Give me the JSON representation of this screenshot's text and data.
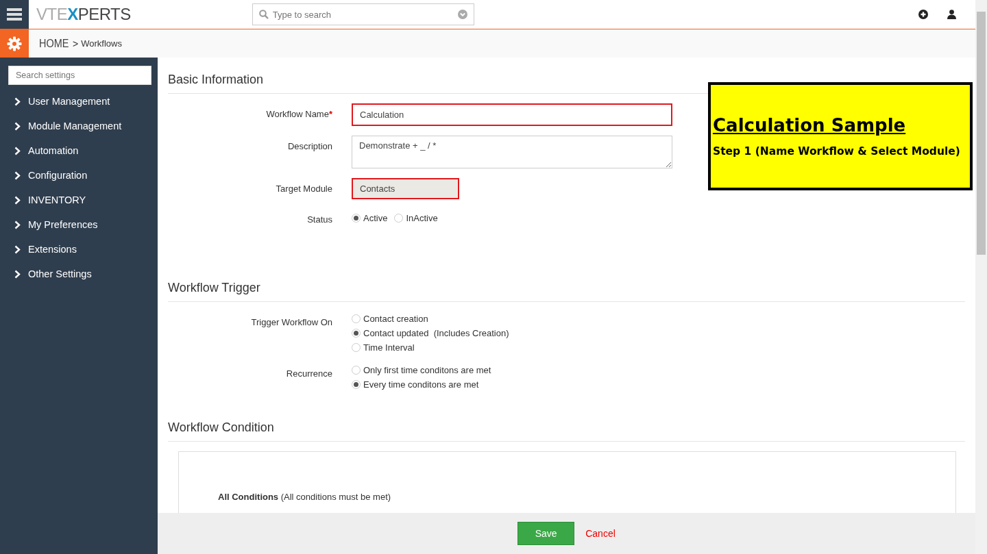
{
  "topbar": {
    "logo": [
      "VTE",
      "X",
      "PERTS"
    ],
    "search": {
      "placeholder": "Type to search"
    }
  },
  "breadcrumb": {
    "home": "HOME",
    "separator": ">",
    "current": "Workflows"
  },
  "sidebar": {
    "search": {
      "placeholder": "Search settings"
    },
    "items": [
      {
        "label": "User Management",
        "expanded": false
      },
      {
        "label": "Module Management",
        "expanded": false
      },
      {
        "label": "Automation",
        "expanded": false
      },
      {
        "label": "Configuration",
        "expanded": false
      },
      {
        "label": "INVENTORY",
        "expanded": false
      },
      {
        "label": "My Preferences",
        "expanded": false
      },
      {
        "label": "Extensions",
        "expanded": false
      },
      {
        "label": "Other Settings",
        "expanded": false
      }
    ]
  },
  "basic": {
    "title": "Basic Information",
    "name_label": "Workflow Name",
    "required_mark": "*",
    "name_value": "Calculation",
    "description_label": "Description",
    "description_value": "Demonstrate + _ / *",
    "module_label": "Target Module",
    "module_value": "Contacts",
    "status_label": "Status",
    "status_options": [
      {
        "label": "Active",
        "selected": true
      },
      {
        "label": "InActive",
        "selected": false
      }
    ]
  },
  "trigger": {
    "title": "Workflow Trigger",
    "on_label": "Trigger Workflow On",
    "on_options": [
      {
        "label": "Contact creation",
        "selected": false
      },
      {
        "label": "Contact updated  (Includes Creation)",
        "selected": true
      },
      {
        "label": "Time Interval",
        "selected": false
      }
    ],
    "recurrence_label": "Recurrence",
    "recurrence_options": [
      {
        "label": "Only first time conditons are met",
        "selected": false
      },
      {
        "label": "Every time conditons are met",
        "selected": true
      }
    ]
  },
  "condition": {
    "title": "Workflow Condition",
    "all_title": "All Conditions",
    "all_note": "(All conditions must be met)"
  },
  "callout": {
    "title": "Calculation Sample",
    "subtitle": "Step 1 (Name Workflow & Select Module)"
  },
  "footer": {
    "save": "Save",
    "cancel": "Cancel"
  }
}
